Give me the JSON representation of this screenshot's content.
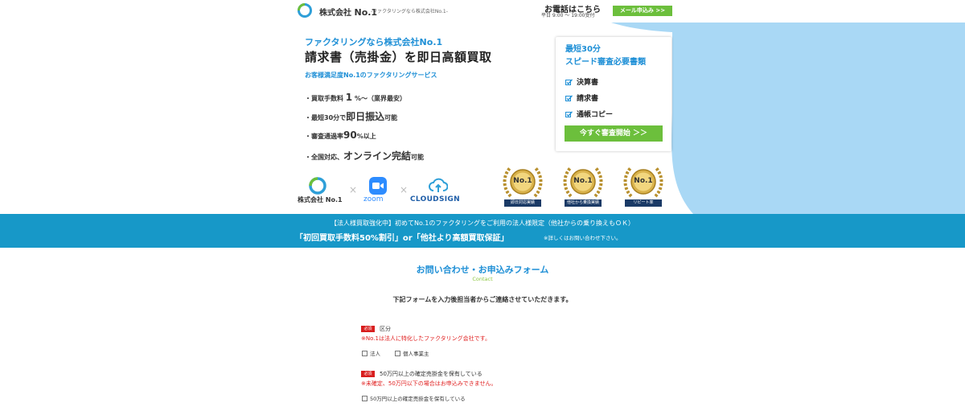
{
  "header": {
    "company_prefix": "株式会社",
    "company_name": "No.1",
    "tagline": "-ファクタリングなら株式会社No.1-",
    "phone_title": "お電話はこちら",
    "phone_hours": "平日 9:00 〜 19:00受付",
    "mail_button": "メール申込み >>"
  },
  "hero": {
    "kicker": "ファクタリングなら株式会社No.1",
    "headline": "請求書（売掛金）を即日高額買取",
    "satisfaction": "お客様満足度No.1のファクタリングサービス",
    "bullets": [
      {
        "pre": "・買取手数料 ",
        "big": "1",
        "post": " %〜（業界最安）"
      },
      {
        "pre": "・最短30分で",
        "big": "即日振込",
        "post": "可能"
      },
      {
        "pre": "・審査通過率",
        "big": "90",
        "post": "%以上"
      },
      {
        "pre": "・全国対応、",
        "big": "オンライン完結",
        "post": "可能"
      }
    ]
  },
  "card": {
    "title_line1": "最短30分",
    "title_line2": "スピード審査必要書類",
    "documents": [
      "決算書",
      "請求書",
      "通帳コピー"
    ],
    "start_button": "今すぐ審査開始 ＞＞"
  },
  "partners": {
    "company_logo_text": "株式会社 No.1",
    "zoom": "zoom",
    "cloudsign": "CLOUDSIGN",
    "separator": "×"
  },
  "badges": [
    {
      "title": "No.1",
      "label": "即日対応実績"
    },
    {
      "title": "No.1",
      "label": "他社から乗換実績"
    },
    {
      "title": "No.1",
      "label": "リピート率"
    }
  ],
  "promo": {
    "line1": "【法人様買取強化中】初めてNo.1のファクタリングをご利用の法人様限定（他社からの乗り換えもＯＫ）",
    "line2": "「初回買取手数料50%割引」or「他社より高額買取保証」",
    "note": "※詳しくはお問い合わせ下さい。"
  },
  "form": {
    "title": "お問い合わせ・お申込みフォーム",
    "subtitle": "Contact",
    "intro": "下記フォームを入力後担当者からご連絡させていただきます。",
    "required": "必須",
    "q1": {
      "label": "区分",
      "warning": "※No.1は法人に特化したファクタリング会社です。",
      "options": [
        "法人",
        "個人事業主"
      ]
    },
    "q2": {
      "label": "50万円以上の確定売掛金を保有している",
      "warning": "※未確定、50万円以下の場合はお申込みできません。",
      "options": [
        "50万円以上の確定売掛金を保有している"
      ]
    }
  },
  "colors": {
    "accent_blue": "#1e8fd6",
    "band_blue": "#1798c8",
    "green": "#6cbf3c",
    "required_red": "#d81e1e",
    "light_blue_bg": "#a9d8f5"
  }
}
